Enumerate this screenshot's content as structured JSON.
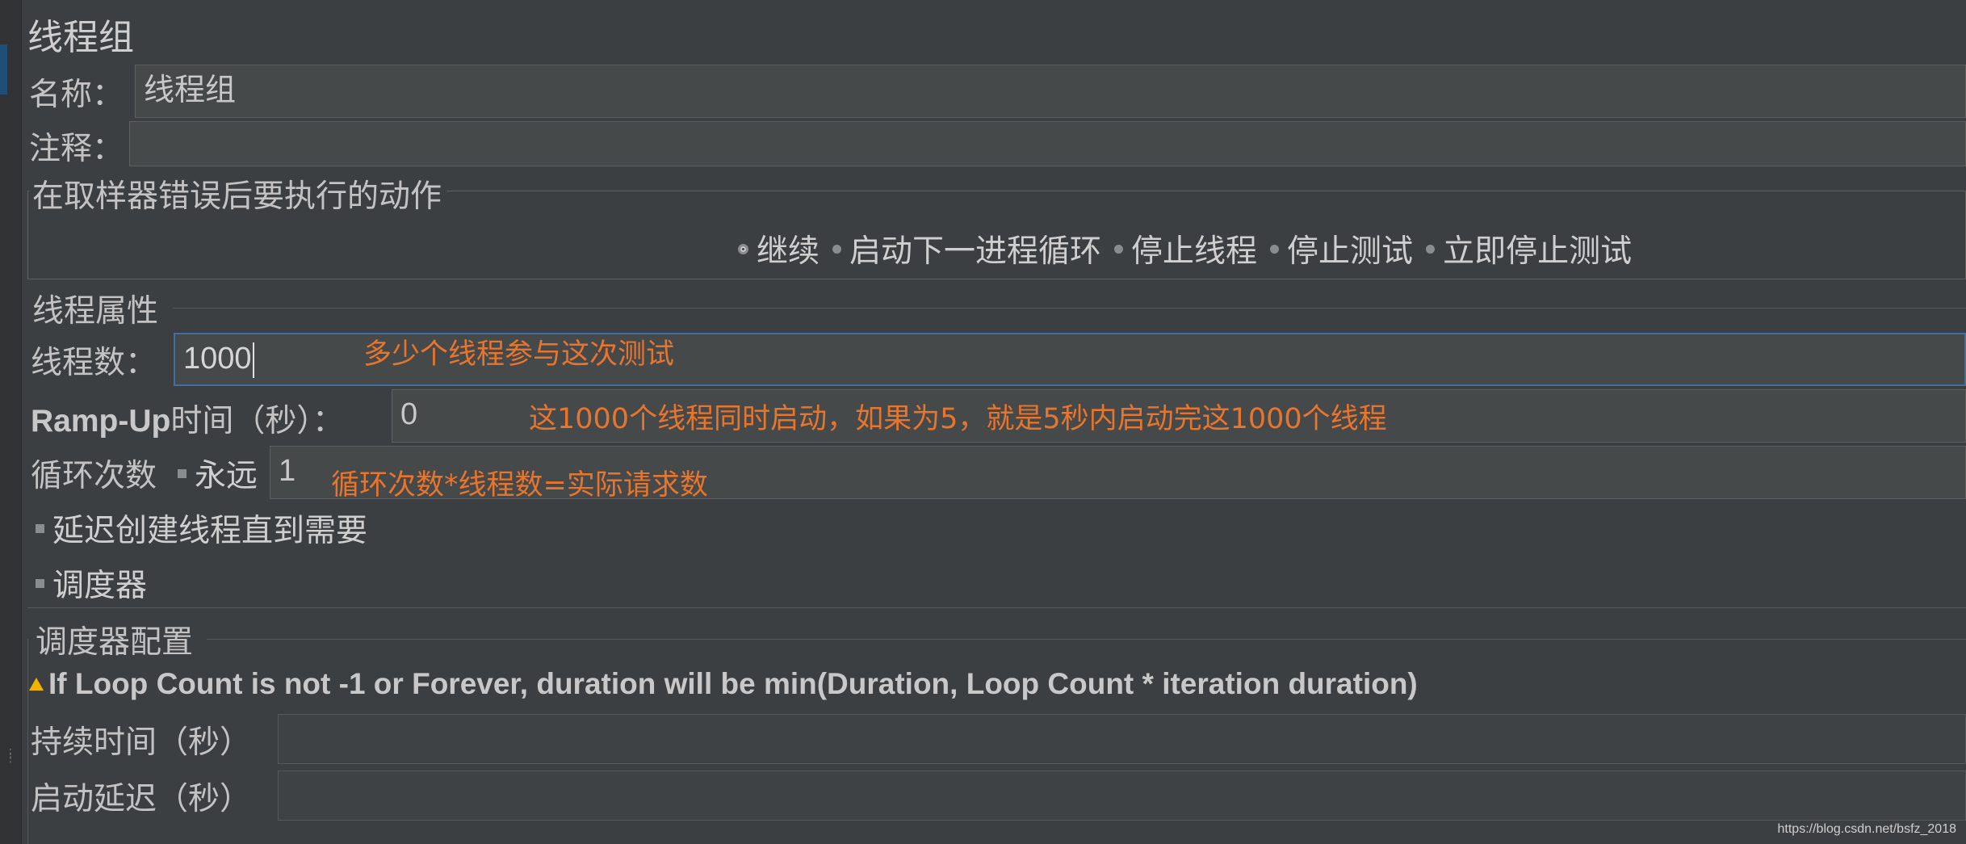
{
  "panel_title": "线程组",
  "name_row": {
    "label": "名称：",
    "value": "线程组"
  },
  "comment_row": {
    "label": "注释：",
    "value": ""
  },
  "error_action": {
    "legend": "在取样器错误后要执行的动作",
    "options": [
      {
        "label": "继续",
        "selected": true
      },
      {
        "label": "启动下一进程循环",
        "selected": false
      },
      {
        "label": "停止线程",
        "selected": false
      },
      {
        "label": "停止测试",
        "selected": false
      },
      {
        "label": "立即停止测试",
        "selected": false
      }
    ]
  },
  "thread_props": {
    "legend": "线程属性",
    "threads": {
      "label": "线程数：",
      "value": "1000",
      "annotation": "多少个线程参与这次测试"
    },
    "rampup": {
      "label_en": "Ramp-Up",
      "label_cn": "时间（秒）：",
      "value": "0",
      "annotation": "这1000个线程同时启动，如果为5，就是5秒内启动完这1000个线程"
    },
    "loop": {
      "label": "循环次数",
      "forever_label": "永远",
      "forever_checked": false,
      "value": "1",
      "annotation": "循环次数*线程数=实际请求数"
    },
    "delay_create": {
      "label": "延迟创建线程直到需要",
      "checked": false
    },
    "scheduler": {
      "label": "调度器",
      "checked": false
    }
  },
  "scheduler_config": {
    "legend": "调度器配置",
    "warning": "If Loop Count is not -1 or Forever, duration will be min(Duration, Loop Count * iteration duration)",
    "duration": {
      "label": "持续时间（秒）",
      "value": ""
    },
    "startup_delay": {
      "label": "启动延迟（秒）",
      "value": ""
    }
  },
  "watermark": "https://blog.csdn.net/bsfz_2018",
  "colors": {
    "background": "#3c3f41",
    "field": "#45494a",
    "annotation": "#e8752d",
    "focus_border": "#3f6fa3",
    "warning": "#f0b400"
  }
}
